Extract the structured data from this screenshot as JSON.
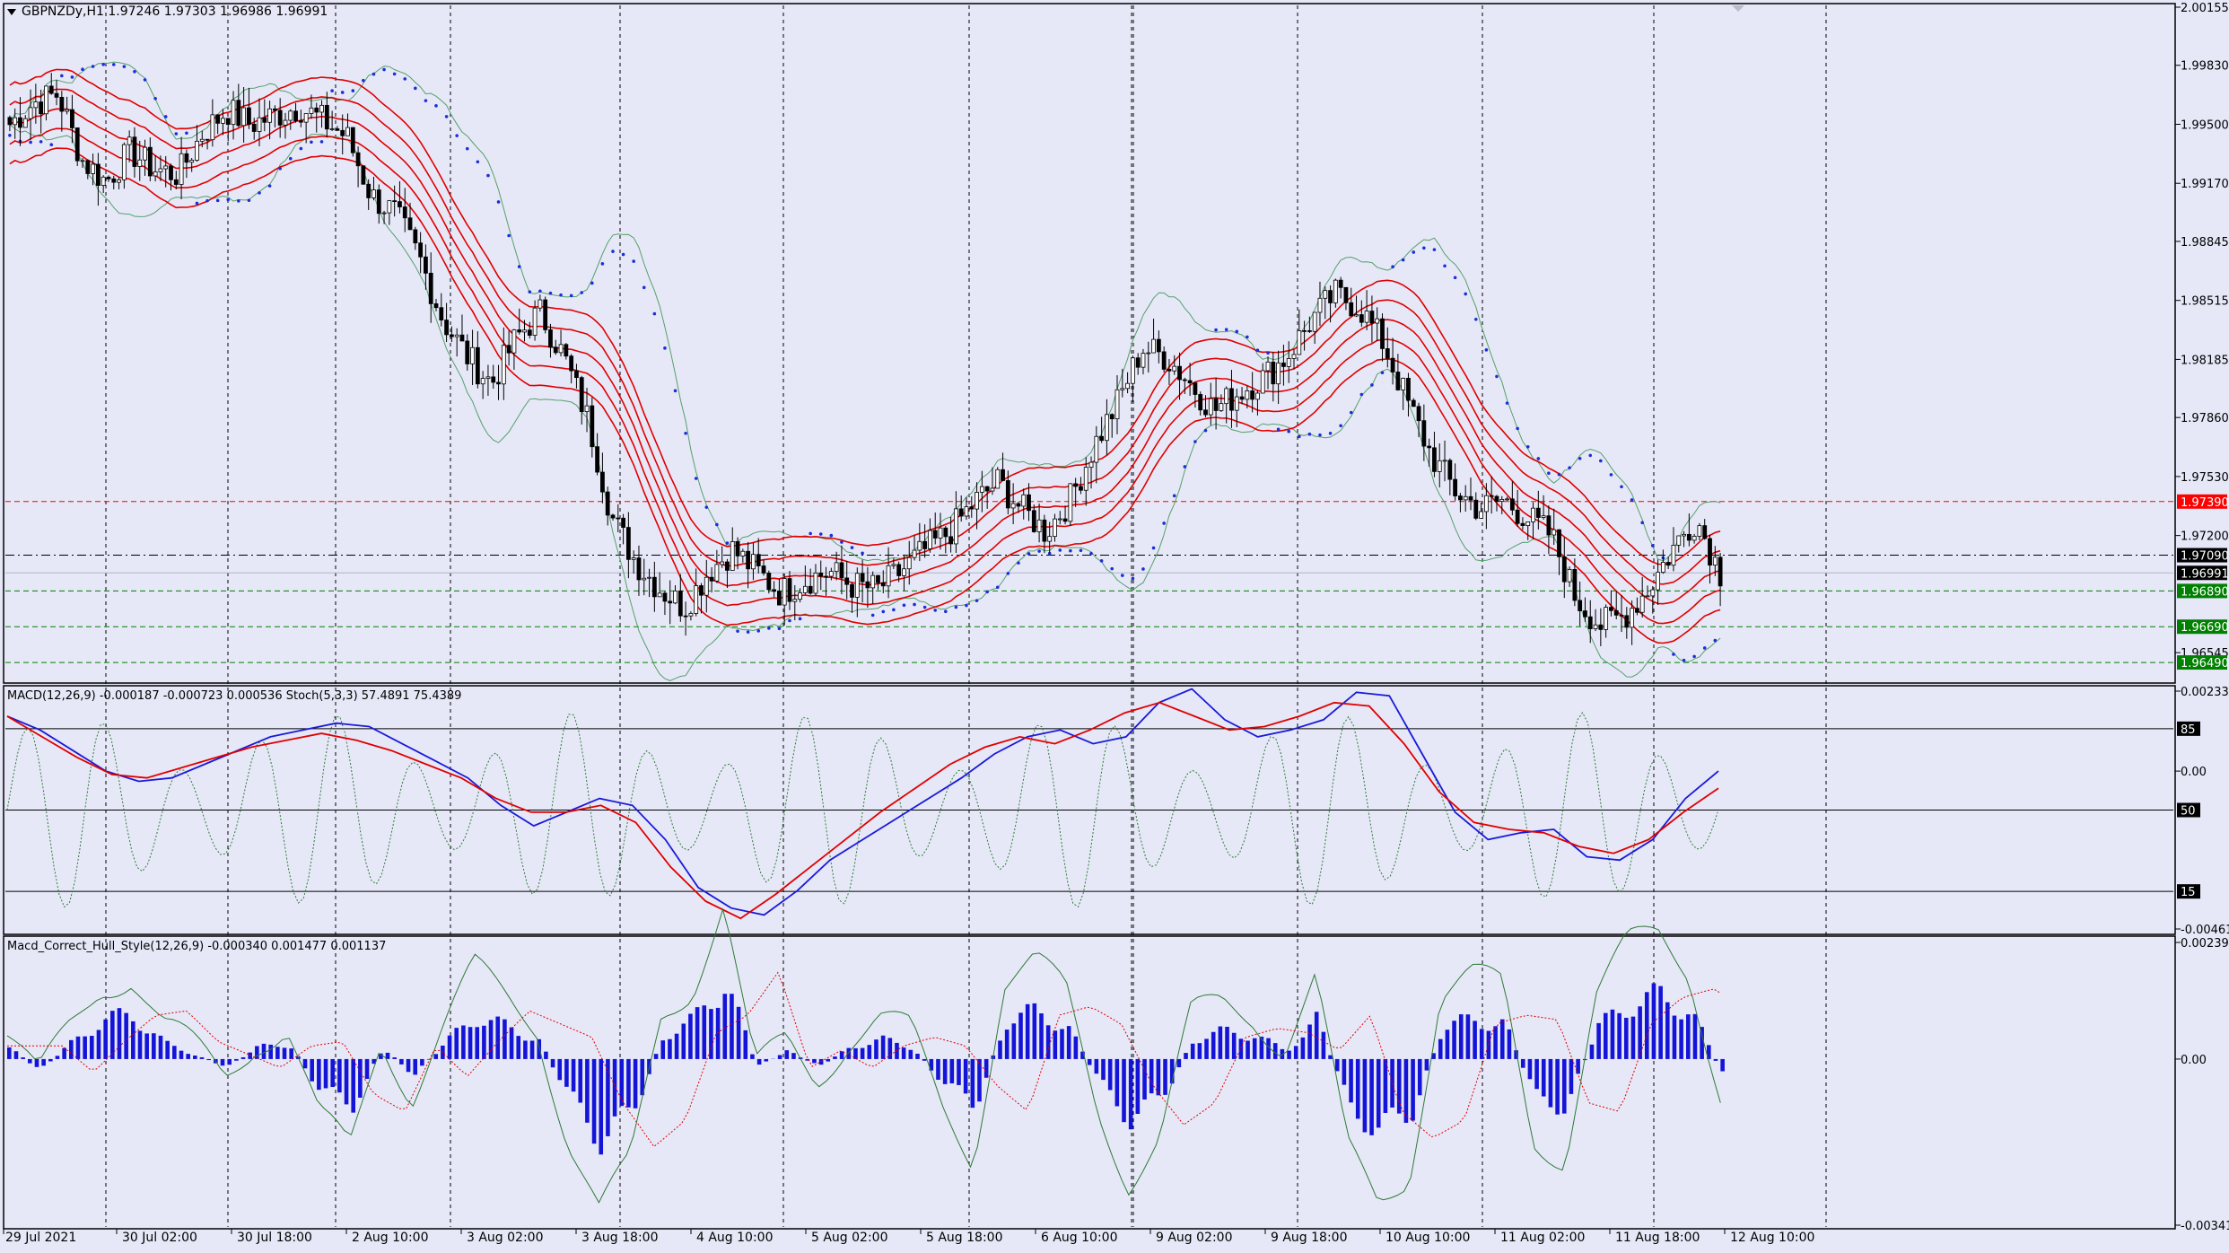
{
  "main_panel": {
    "title": "GBPNZDy,H1  1.97246 1.97303 1.96986 1.96991",
    "price_scale": [
      "2.00155",
      "1.99830",
      "1.99500",
      "1.99170",
      "1.98845",
      "1.98515",
      "1.98185",
      "1.97860",
      "1.97530",
      "1.97200",
      "1.96545"
    ],
    "levels": [
      {
        "label": "1.97390",
        "color": "#ff0000",
        "price": 1.9739,
        "style": "dash"
      },
      {
        "label": "1.97090",
        "color": "#000000",
        "price": 1.9709,
        "style": "dashdot"
      },
      {
        "label": "1.96991",
        "color": "#000000",
        "price": 1.96991,
        "style": "solid"
      },
      {
        "label": "1.96890",
        "color": "#008000",
        "price": 1.9689,
        "style": "dash"
      },
      {
        "label": "1.96690",
        "color": "#008000",
        "price": 1.9669,
        "style": "dash"
      },
      {
        "label": "1.96490",
        "color": "#008000",
        "price": 1.9649,
        "style": "dash"
      }
    ]
  },
  "macd_panel": {
    "title": "MACD(12,26,9) -0.000187 -0.000723 0.000536  Stoch(5,3,3) 57.4891 75.4389",
    "scale": [
      "0.002335",
      "0.00",
      "-0.00461"
    ],
    "stoch_levels": [
      "85",
      "50",
      "15"
    ]
  },
  "hull_panel": {
    "title": "Macd_Correct_Hull_Style(12,26,9) -0.000340 0.001477 0.001137",
    "scale": [
      "0.002394",
      "0.00",
      "-0.00341"
    ]
  },
  "time_axis": [
    "29 Jul 2021",
    "30 Jul 02:00",
    "30 Jul 18:00",
    "2 Aug 10:00",
    "3 Aug 02:00",
    "3 Aug 18:00",
    "4 Aug 10:00",
    "5 Aug 02:00",
    "5 Aug 18:00",
    "6 Aug 10:00",
    "9 Aug 02:00",
    "9 Aug 18:00",
    "10 Aug 10:00",
    "11 Aug 02:00",
    "11 Aug 18:00",
    "12 Aug 10:00"
  ],
  "chart_data": {
    "type": "candlestick",
    "symbol": "GBPNZDy",
    "timeframe": "H1",
    "ohlc_last": {
      "open": 1.97246,
      "high": 1.97303,
      "low": 1.96986,
      "close": 1.96991
    },
    "close_series": [
      1.995,
      1.9962,
      1.9967,
      1.993,
      1.9918,
      1.9935,
      1.9925,
      1.9922,
      1.9945,
      1.9958,
      1.995,
      1.9955,
      1.996,
      1.9952,
      1.9943,
      1.991,
      1.99,
      1.9875,
      1.984,
      1.982,
      1.9805,
      1.983,
      1.9845,
      1.982,
      1.9785,
      1.973,
      1.9705,
      1.969,
      1.968,
      1.97,
      1.9712,
      1.97,
      1.9688,
      1.9695,
      1.97,
      1.9692,
      1.969,
      1.97,
      1.9712,
      1.9722,
      1.9738,
      1.975,
      1.9735,
      1.9722,
      1.974,
      1.977,
      1.9795,
      1.9825,
      1.982,
      1.9805,
      1.979,
      1.98,
      1.9808,
      1.982,
      1.984,
      1.9855,
      1.9848,
      1.9828,
      1.9795,
      1.9765,
      1.9745,
      1.9735,
      1.974,
      1.973,
      1.972,
      1.9685,
      1.967,
      1.9675,
      1.969,
      1.9712,
      1.973,
      1.9699
    ],
    "macd_main": [
      0.0016,
      0.0012,
      0.0006,
      0.0,
      -0.0003,
      -0.0002,
      0.0002,
      0.0006,
      0.001,
      0.0012,
      0.0014,
      0.0013,
      0.0008,
      0.0003,
      -0.0002,
      -0.001,
      -0.0016,
      -0.0012,
      -0.0008,
      -0.001,
      -0.002,
      -0.0034,
      -0.004,
      -0.0042,
      -0.0035,
      -0.0026,
      -0.002,
      -0.0014,
      -0.0008,
      -0.0002,
      0.0005,
      0.001,
      0.0012,
      0.0008,
      0.001,
      0.002,
      0.0024,
      0.0015,
      0.001,
      0.0012,
      0.0015,
      0.0023,
      0.0022,
      0.0005,
      -0.0012,
      -0.002,
      -0.0018,
      -0.0017,
      -0.0025,
      -0.0026,
      -0.002,
      -0.0008,
      0.0
    ],
    "macd_signal": [
      0.0016,
      0.001,
      0.0004,
      -0.0001,
      -0.0002,
      0.0001,
      0.0004,
      0.0007,
      0.0009,
      0.0011,
      0.0009,
      0.0006,
      0.0002,
      -0.0002,
      -0.0008,
      -0.0012,
      -0.0012,
      -0.001,
      -0.0015,
      -0.0028,
      -0.0038,
      -0.0043,
      -0.0036,
      -0.0028,
      -0.002,
      -0.0012,
      -0.0005,
      0.0002,
      0.0007,
      0.001,
      0.0008,
      0.0012,
      0.0017,
      0.002,
      0.0016,
      0.0012,
      0.0013,
      0.0016,
      0.002,
      0.0019,
      0.0008,
      -0.0006,
      -0.0015,
      -0.0017,
      -0.0018,
      -0.0022,
      -0.0024,
      -0.002,
      -0.0012,
      -0.0005
    ],
    "hull_histogram": [
      0.0003,
      -0.0003,
      0.0004,
      0.001,
      0.0011,
      0.0004,
      0.0001,
      -0.0002,
      0.0003,
      0.0004,
      -0.0008,
      -0.0012,
      0.0003,
      -0.0004,
      0.0004,
      0.0011,
      0.0008,
      0.0005,
      -0.001,
      -0.002,
      -0.0014,
      0.0006,
      0.001,
      0.002,
      -0.0002,
      0.0002,
      -0.0002,
      0.0003,
      0.0005,
      0.0003,
      -0.0006,
      -0.0012,
      0.001,
      0.0012,
      0.0008,
      -0.0006,
      -0.0015,
      -0.001,
      0.0005,
      0.0007,
      0.0006,
      0.0002,
      0.001,
      -0.0012,
      -0.0018,
      -0.0014,
      0.0008,
      0.001,
      0.0009,
      -0.001,
      -0.0012,
      0.0008,
      0.0014,
      0.0016,
      0.0012,
      -0.0004
    ]
  }
}
